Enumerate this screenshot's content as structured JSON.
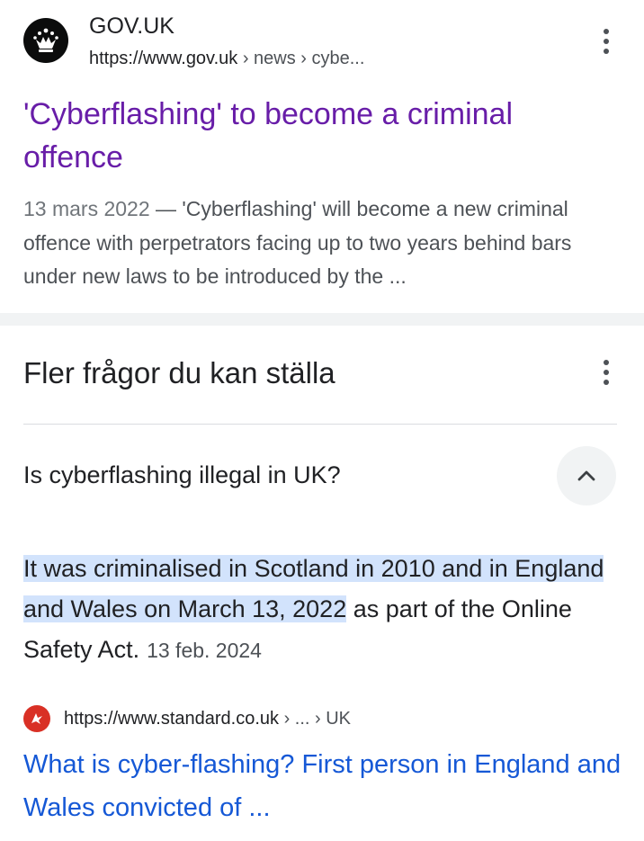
{
  "result1": {
    "site_name": "GOV.UK",
    "url_base": "https://www.gov.uk",
    "url_path": " › news › cybe...",
    "title": "'Cyberflashing' to become a criminal offence",
    "snippet_date": "13 mars 2022",
    "snippet_text": " — 'Cyberflashing' will become a new criminal offence with perpetrators facing up to two years behind bars under new laws to be introduced by the ...",
    "logo_icon": "crown-icon",
    "logo_color": "#0b0c0c"
  },
  "paa": {
    "heading": "Fler frågor du kan ställa",
    "question": "Is cyberflashing illegal in UK?",
    "answer_highlight": "It was criminalised in Scotland in 2010 and in England and Wales on March 13, 2022",
    "answer_rest": " as part of the Online Safety Act.",
    "answer_date": "13 feb. 2024",
    "highlight_color": "#d2e3fc",
    "collapse_icon": "chevron-up-icon",
    "source": {
      "url_base": "https://www.standard.co.uk",
      "url_path": " › ... › UK",
      "title": "What is cyber-flashing? First person in England and Wales convicted of ...",
      "logo_icon": "standard-logo-icon",
      "logo_color": "#d93025"
    }
  },
  "colors": {
    "visited_link": "#681da8",
    "link": "#1558d6",
    "text": "#202124",
    "secondary_text": "#4d5156"
  }
}
